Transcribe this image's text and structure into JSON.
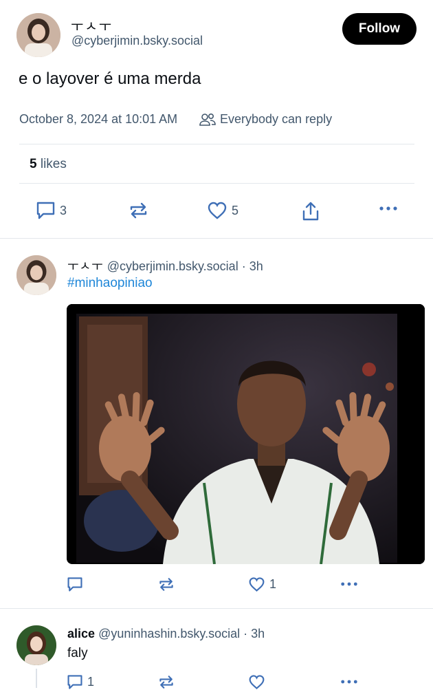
{
  "main_post": {
    "author_name": "ㅜㅅㅜ",
    "author_handle": "@cyberjimin.bsky.social",
    "follow_label": "Follow",
    "text": "e o layover é uma merda",
    "timestamp": "October 8, 2024 at 10:01 AM",
    "reply_setting": "Everybody can reply",
    "likes_count": "5",
    "likes_label": "likes",
    "reply_count": "3",
    "like_count": "5"
  },
  "reply_1": {
    "author_name": "ㅜㅅㅜ",
    "author_handle": "@cyberjimin.bsky.social",
    "separator": "·",
    "time_ago": "3h",
    "hashtag": "#minhaopiniao",
    "like_count": "1"
  },
  "reply_2": {
    "author_name": "alice",
    "author_handle": "@yuninhashin.bsky.social",
    "separator": "·",
    "time_ago": "3h",
    "text": "faly",
    "reply_count": "1"
  },
  "colors": {
    "text": "#0b0f14",
    "muted": "#42576c",
    "link": "#1e86d8",
    "button": "#000000",
    "divider": "#e3e7ec"
  }
}
